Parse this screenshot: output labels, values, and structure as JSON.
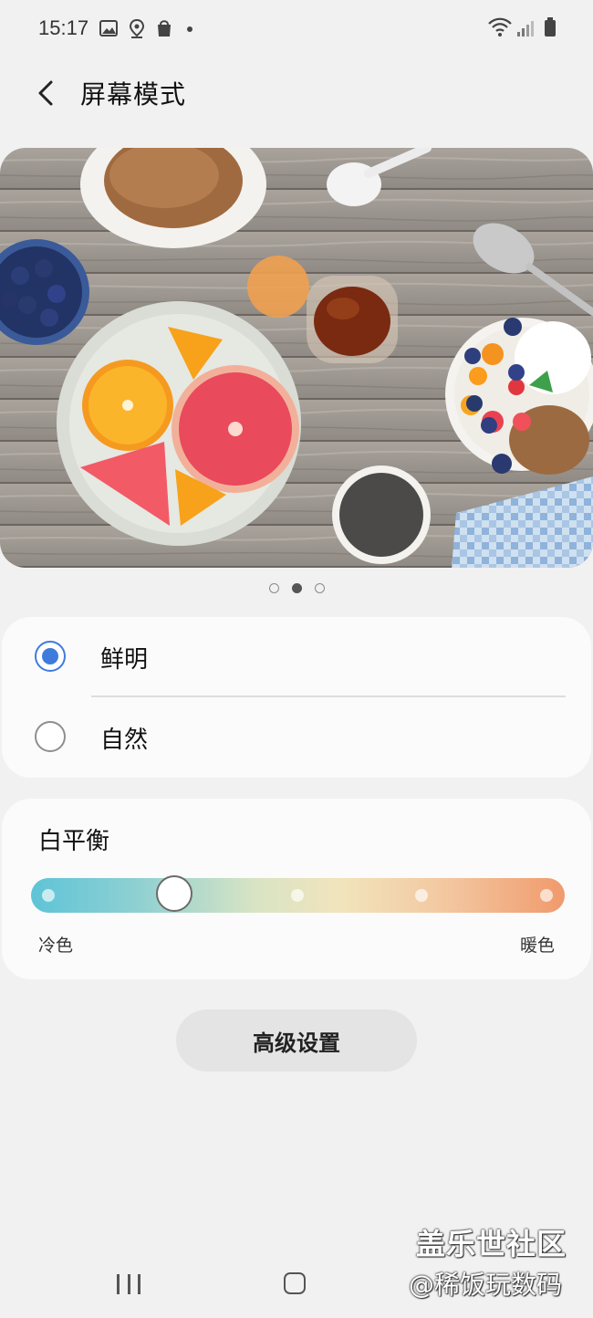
{
  "status_bar": {
    "time": "15:17",
    "left_icons": [
      "image-icon",
      "location-icon",
      "shopping-bag-icon",
      "dot-icon"
    ],
    "right_icons": [
      "wifi-icon",
      "signal-icon",
      "battery-icon"
    ]
  },
  "header": {
    "title": "屏幕模式",
    "back_icon": "back-arrow-icon"
  },
  "preview": {
    "page_count": 3,
    "active_page": 2
  },
  "screen_mode": {
    "options": [
      {
        "label": "鲜明",
        "selected": true
      },
      {
        "label": "自然",
        "selected": false
      }
    ],
    "accent_color": "#3e7bdc"
  },
  "white_balance": {
    "title": "白平衡",
    "cool_label": "冷色",
    "warm_label": "暖色",
    "steps": 5,
    "value_step": 2,
    "gradient_colors": [
      "#5ec4d7",
      "#f1e4bc",
      "#f09a6c"
    ]
  },
  "advanced_button": {
    "label": "高级设置"
  },
  "nav": {
    "icons": [
      "recents-icon",
      "home-icon"
    ]
  },
  "watermark": {
    "line1": "盖乐世社区",
    "line2": "@稀饭玩数码"
  }
}
